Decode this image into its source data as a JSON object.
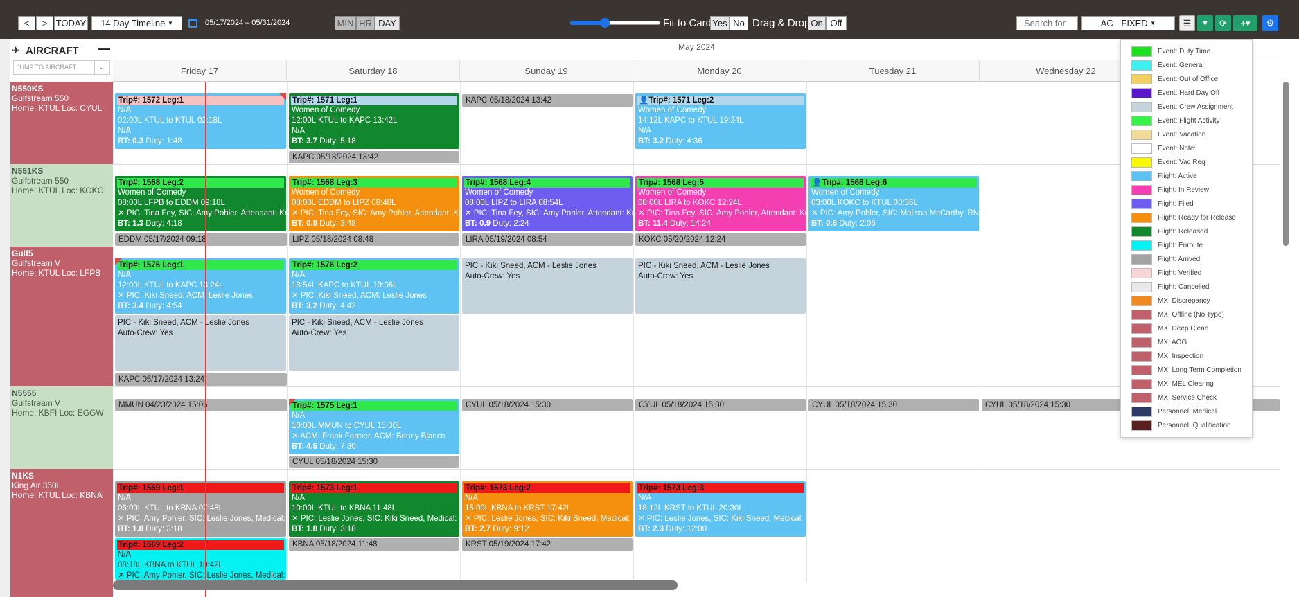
{
  "toolbar": {
    "prev": "<",
    "next": ">",
    "today": "TODAY",
    "view": "14 Day Timeline",
    "range": "05/17/2024 – 05/31/2024",
    "min": "MIN",
    "hr": "HR",
    "day": "DAY",
    "fit": "Fit to Card",
    "yes": "Yes",
    "no": "No",
    "drag": "Drag & Drop",
    "on": "On",
    "off": "Off",
    "search_placeholder": "Search for",
    "filter": "AC - FIXED"
  },
  "sidebar": {
    "title": "AIRCRAFT",
    "jump_placeholder": "JUMP TO AIRCRAFT"
  },
  "month": "May 2024",
  "days": [
    "Friday 17",
    "Saturday 18",
    "Sunday 19",
    "Monday 20",
    "Tuesday 21",
    "Wednesday 22"
  ],
  "aircraft": [
    {
      "reg": "N550KS",
      "type": "Gulfstream 550",
      "home": "Home: KTUL Loc: CYUL"
    },
    {
      "reg": "N551KS",
      "type": "Gulfstream 550",
      "home": "Home: KTUL Loc: KOKC"
    },
    {
      "reg": "Gulf5",
      "type": "Gulfstream V",
      "home": "Home: KTUL Loc: LFPB"
    },
    {
      "reg": "N5555",
      "type": "Gulfstream V",
      "home": "Home: KBFI Loc: EGGW"
    },
    {
      "reg": "N1KS",
      "type": "King Air 350i",
      "home": "Home: KTUL Loc: KBNA"
    }
  ],
  "cards": {
    "c1572": {
      "h": "Trip#: 1572 Leg:1",
      "l1": "N/A",
      "l2": "02:00L KTUL to KTUL 02:18L",
      "l3": "N/A",
      "bt": "BT: 0.3",
      "duty": "Duty: 1:48"
    },
    "c1571a": {
      "h": "Trip#: 1571 Leg:1",
      "l1": "Women of Comedy",
      "l2": "12:00L KTUL to KAPC 13:42L",
      "l3": "N/A",
      "bt": "BT: 3.7",
      "duty": "Duty: 5:18"
    },
    "c1571b": {
      "h": "Trip#: 1571 Leg:2",
      "l1": "Women of Comedy",
      "l2": "14:12L KAPC to KTUL 19:24L",
      "l3": "N/A",
      "bt": "BT: 3.2",
      "duty": "Duty: 4:36"
    },
    "c1568a": {
      "h": "Trip#: 1568 Leg:2",
      "l1": "Women of Comedy",
      "l2": "08:00L LFPB to EDDM 09:18L",
      "l3": "✕ PIC: Tina Fey, SIC: Amy Pohler, Attendant: Kr",
      "bt": "BT: 1.3",
      "duty": "Duty: 4:18"
    },
    "c1568b": {
      "h": "Trip#: 1568 Leg:3",
      "l1": "Women of Comedy",
      "l2": "08:00L EDDM to LIPZ 08:48L",
      "l3": "✕ PIC: Tina Fey, SIC: Amy Pohler, Attendant: Kr",
      "bt": "BT: 0.8",
      "duty": "Duty: 3:48"
    },
    "c1568c": {
      "h": "Trip#: 1568 Leg:4",
      "l1": "Women of Comedy",
      "l2": "08:00L LIPZ to LIRA 08:54L",
      "l3": "✕ PIC: Tina Fey, SIC: Amy Pohler, Attendant: Kr",
      "bt": "BT: 0.9",
      "duty": "Duty: 2:24"
    },
    "c1568d": {
      "h": "Trip#: 1568 Leg:5",
      "l1": "Women of Comedy",
      "l2": "08:00L LIRA to KOKC 12:24L",
      "l3": "✕ PIC: Tina Fey, SIC: Amy Pohler, Attendant: Kr",
      "bt": "BT: 11.4",
      "duty": "Duty: 14:24"
    },
    "c1568e": {
      "h": "Trip#: 1568 Leg:6",
      "l1": "Women of Comedy",
      "l2": "03:00L KOKC to KTUL 03:36L",
      "l3": "✕ PIC: Amy Pohler, SIC: Melissa McCarthy, RN",
      "bt": "BT: 0.6",
      "duty": "Duty: 2:06"
    },
    "c1576a": {
      "h": "Trip#: 1576 Leg:1",
      "l1": "N/A",
      "l2": "12:00L KTUL to KAPC 13:24L",
      "l3": "✕ PIC: Kiki Sneed, ACM: Leslie Jones",
      "bt": "BT: 3.4",
      "duty": "Duty: 4:54"
    },
    "c1576b": {
      "h": "Trip#: 1576 Leg:2",
      "l1": "N/A",
      "l2": "13:54L KAPC to KTUL 19:06L",
      "l3": "✕ PIC: Kiki Sneed, ACM: Leslie Jones",
      "bt": "BT: 3.2",
      "duty": "Duty: 4:42"
    },
    "c1575": {
      "h": "Trip#: 1575 Leg:1",
      "l1": "N/A",
      "l2": "10:00L MMUN to CYUL 15:30L",
      "l3": "✕ ACM: Frank Farmer, ACM: Benny Blanco",
      "bt": "BT: 4.5",
      "duty": "Duty: 7:30"
    },
    "c1569a": {
      "h": "Trip#: 1569 Leg:1",
      "l1": "N/A",
      "l2": "06:00L KTUL to KBNA 07:48L",
      "l3": "✕ PIC: Amy Pohler, SIC: Leslie Jones, Medical: N",
      "bt": "BT: 1.8",
      "duty": "Duty: 3:18"
    },
    "c1573a": {
      "h": "Trip#: 1573 Leg:1",
      "l1": "N/A",
      "l2": "10:00L KTUL to KBNA 11:48L",
      "l3": "✕ PIC: Leslie Jones, SIC: Kiki Sneed, Medical: M",
      "bt": "BT: 1.8",
      "duty": "Duty: 3:18"
    },
    "c1573b": {
      "h": "Trip#: 1573 Leg:2",
      "l1": "N/A",
      "l2": "15:00L KBNA to KRST 17:42L",
      "l3": "✕ PIC: Leslie Jones, SIC: Kiki Sneed, Medical: M",
      "bt": "BT: 2.7",
      "duty": "Duty: 9:12"
    },
    "c1573c": {
      "h": "Trip#: 1573 Leg:3",
      "l1": "N/A",
      "l2": "18:12L KRST to KTUL 20:30L",
      "l3": "✕ PIC: Leslie Jones, SIC: Kiki Sneed, Medical: M",
      "bt": "BT: 2.3",
      "duty": "Duty: 12:00"
    },
    "c1569b": {
      "h": "Trip#: 1569 Leg:2",
      "l1": "N/A",
      "l2": "08:18L KBNA to KTUL 10:42L",
      "l3": "✕ PIC: Amy Pohler, SIC: Leslie Jones, Medical: N"
    }
  },
  "crew": {
    "l1": "PIC - Kiki Sneed, ACM - Leslie Jones",
    "l2": "Auto-Crew: Yes"
  },
  "bars": {
    "b1": "KAPC 05/18/2024 13:42",
    "b2": "KAPC 05/18/2024 13:42",
    "b3": "EDDM 05/17/2024 09:18",
    "b4": "LIPZ 05/18/2024 08:48",
    "b5": "LIRA 05/19/2024 08:54",
    "b6": "KOKC 05/20/2024 12:24",
    "b7": "KAPC 05/17/2024 13:24",
    "b8": "MMUN 04/23/2024 15:06",
    "b9": "CYUL 05/18/2024 15:30",
    "b10": "CYUL 05/18/2024 15:30",
    "b11": "CYUL 05/18/2024 15:30",
    "b12": "CYUL 05/18/2024 15:30",
    "b13": "CYUL 05/18/2024 15:30",
    "b14": "KBNA 05/18/2024 11:48",
    "b15": "KRST 05/19/2024 17:42"
  },
  "legend": [
    {
      "label": "Event: Duty Time",
      "color": "#1ee01e"
    },
    {
      "label": "Event: General",
      "color": "#3ff0f0"
    },
    {
      "label": "Event: Out of Office",
      "color": "#f0d060"
    },
    {
      "label": "Event: Hard Day Off",
      "color": "#5a18c8"
    },
    {
      "label": "Event: Crew Assignment",
      "color": "#c5d3dd"
    },
    {
      "label": "Event: Flight Activity",
      "color": "#3af04a"
    },
    {
      "label": "Event: Vacation",
      "color": "#f0dc98"
    },
    {
      "label": "Event: Note:",
      "color": "#ffffff"
    },
    {
      "label": "Event: Vac Req",
      "color": "#f8f800"
    },
    {
      "label": "Flight: Active",
      "color": "#5ec3f3"
    },
    {
      "label": "Flight: In Review",
      "color": "#f33fb2"
    },
    {
      "label": "Flight: Filed",
      "color": "#6e5ef0"
    },
    {
      "label": "Flight: Ready for Release",
      "color": "#f5900f"
    },
    {
      "label": "Flight: Released",
      "color": "#12882e"
    },
    {
      "label": "Flight: Enroute",
      "color": "#04f2f2"
    },
    {
      "label": "Flight: Arrived",
      "color": "#a3a3a3"
    },
    {
      "label": "Flight: Verified",
      "color": "#f6d6d6"
    },
    {
      "label": "Flight: Cancelled",
      "color": "#e8e8e8"
    },
    {
      "label": "MX: Discrepancy",
      "color": "#f08a20"
    },
    {
      "label": "MX: Offline (No Type)",
      "color": "#c0606a"
    },
    {
      "label": "MX: Deep Clean",
      "color": "#c0606a"
    },
    {
      "label": "MX: AOG",
      "color": "#c0606a"
    },
    {
      "label": "MX: Inspection",
      "color": "#c0606a"
    },
    {
      "label": "MX: Long Term Completion",
      "color": "#c0606a"
    },
    {
      "label": "MX: MEL Clearing",
      "color": "#c0606a"
    },
    {
      "label": "MX: Service Check",
      "color": "#c0606a"
    },
    {
      "label": "Personnel: Medical",
      "color": "#2e3a66"
    },
    {
      "label": "Personnel: Qualification",
      "color": "#5a2020"
    }
  ]
}
